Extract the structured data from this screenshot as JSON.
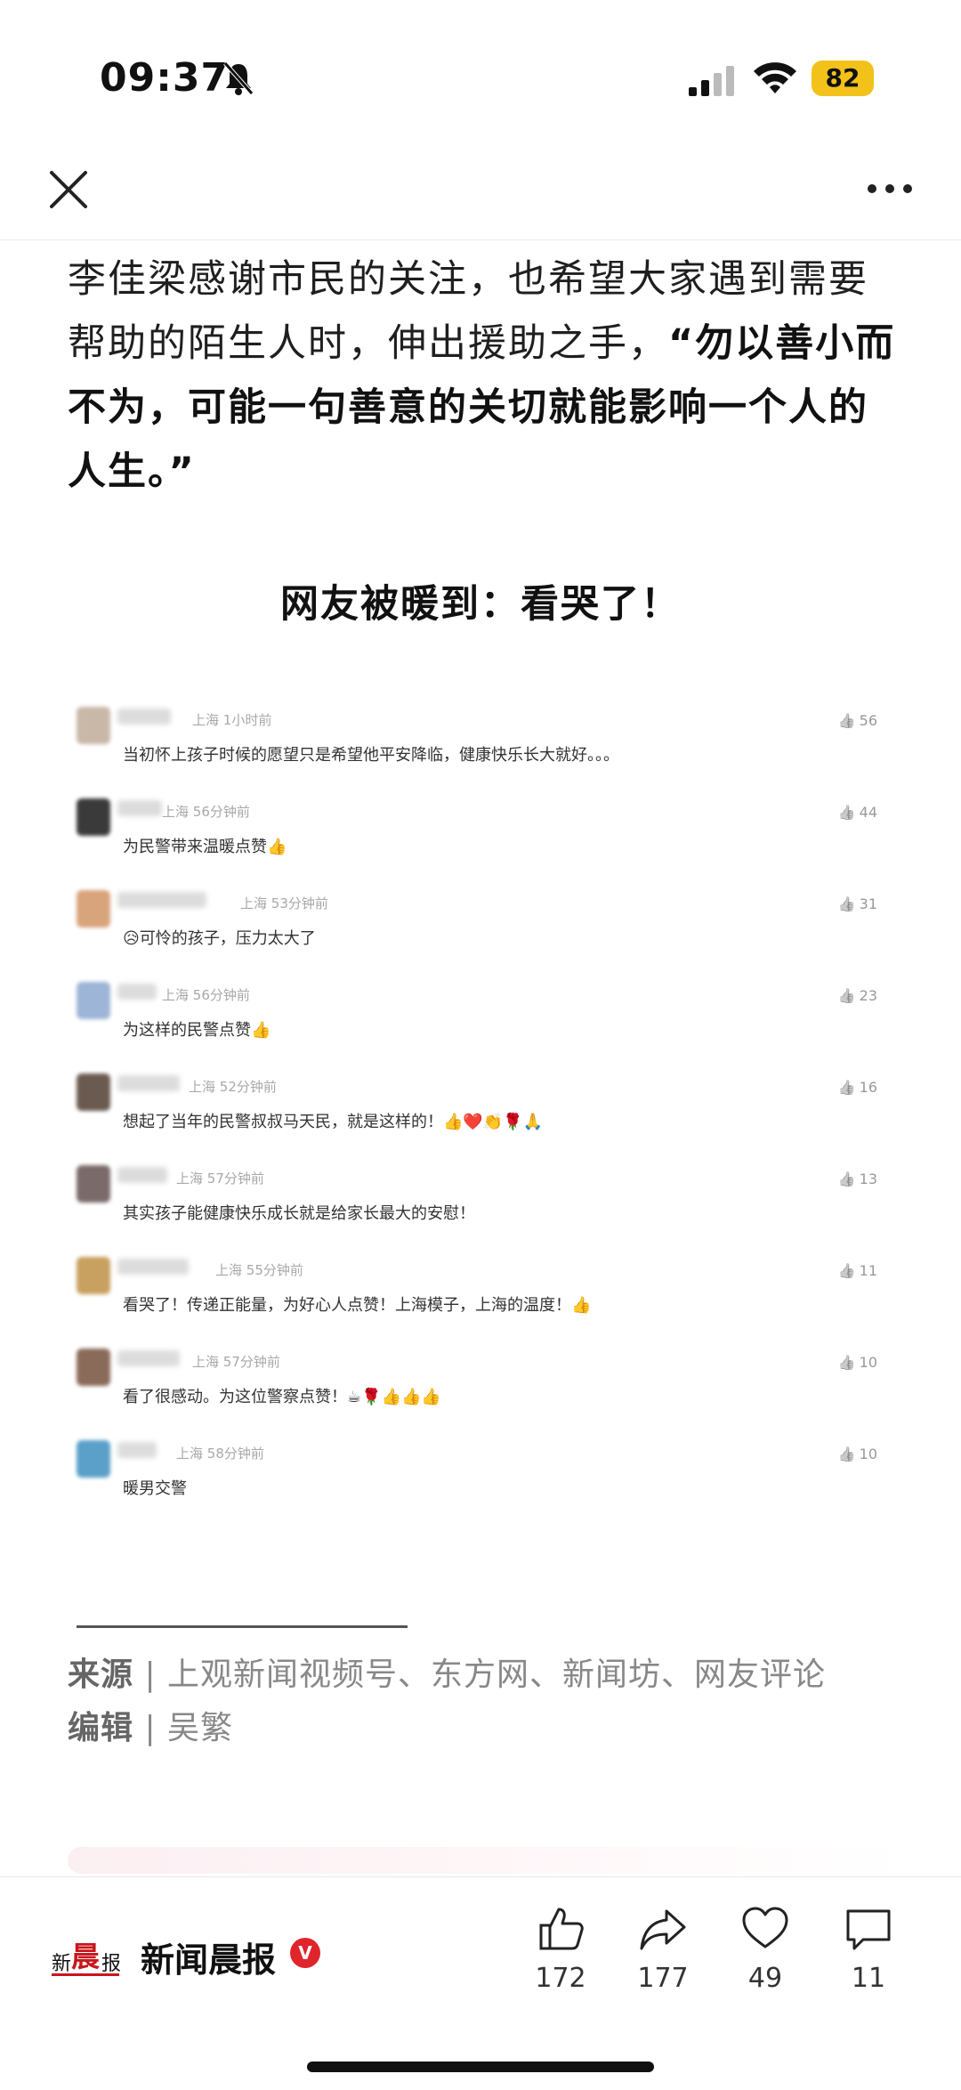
{
  "status_bar": {
    "time": "09:37",
    "battery": "82"
  },
  "article": {
    "paragraph_plain": "李佳梁感谢市民的关注，也希望大家遇到需要帮助的陌生人时，伸出援助之手，",
    "paragraph_bold": "“勿以善小而不为，可能一句善意的关切就能影响一个人的人生。”",
    "heading": "网友被暖到：看哭了！"
  },
  "comments": [
    {
      "location": "上海",
      "time": "1小时前",
      "text": "当初怀上孩子时候的愿望只是希望他平安降临，健康快乐长大就好。。。",
      "likes": "56",
      "avatar_color": "#c9b8a8"
    },
    {
      "location": "上海",
      "time": "56分钟前",
      "text": "为民警带来温暖点赞👍",
      "likes": "44",
      "avatar_color": "#3a3a3a"
    },
    {
      "location": "上海",
      "time": "53分钟前",
      "text": "😥可怜的孩子，压力太大了",
      "likes": "31",
      "avatar_color": "#d8a47c"
    },
    {
      "location": "上海",
      "time": "56分钟前",
      "text": "为这样的民警点赞👍",
      "likes": "23",
      "avatar_color": "#9db5d6"
    },
    {
      "location": "上海",
      "time": "52分钟前",
      "text": "想起了当年的民警叔叔马天民，就是这样的！👍❤️👏🌹🙏",
      "likes": "16",
      "avatar_color": "#6b5a50"
    },
    {
      "location": "上海",
      "time": "57分钟前",
      "text": "其实孩子能健康快乐成长就是给家长最大的安慰！",
      "likes": "13",
      "avatar_color": "#7a6a6a"
    },
    {
      "location": "上海",
      "time": "55分钟前",
      "text": "看哭了！传递正能量，为好心人点赞！上海模子，上海的温度！👍",
      "likes": "11",
      "avatar_color": "#c8a060"
    },
    {
      "location": "上海",
      "time": "57分钟前",
      "text": "看了很感动。为这位警察点赞！☕🌹👍👍👍",
      "likes": "10",
      "avatar_color": "#8a6a58"
    },
    {
      "location": "上海",
      "time": "58分钟前",
      "text": "暖男交警",
      "likes": "10",
      "avatar_color": "#5aa0c8"
    }
  ],
  "source": {
    "source_label": "来源",
    "source_value": "上观新闻视频号、东方网、新闻坊、网友评论",
    "editor_label": "编辑",
    "editor_value": "吴繁"
  },
  "bottom_bar": {
    "publisher": "新闻晨报",
    "verified_mark": "V",
    "like_count": "172",
    "share_count": "177",
    "favorite_count": "49",
    "comment_count": "11"
  },
  "icons": [
    "bell-off-icon",
    "signal-icon",
    "wifi-icon",
    "close-icon",
    "more-icon",
    "thumb-up-icon",
    "share-icon",
    "heart-icon",
    "comment-icon"
  ]
}
